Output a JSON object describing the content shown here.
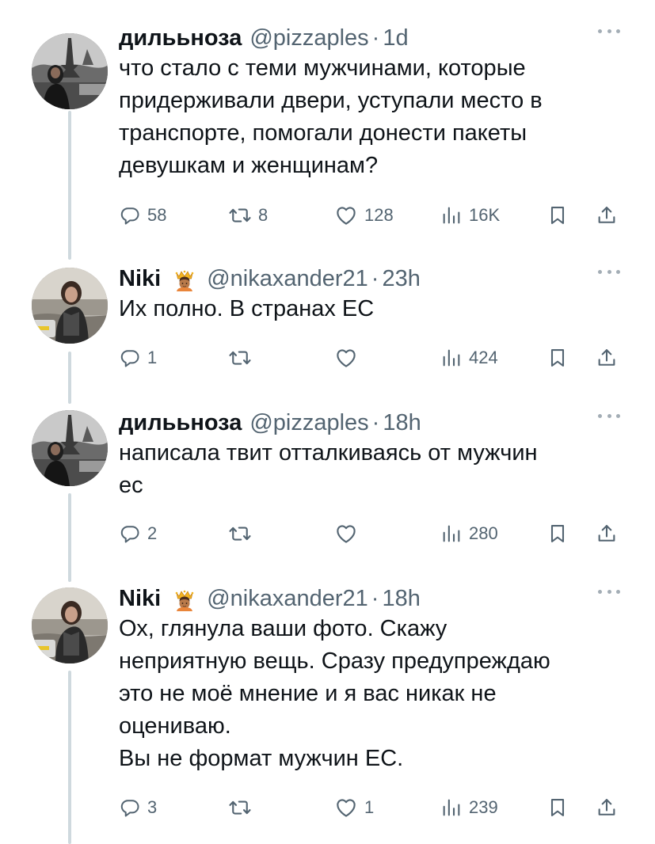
{
  "tweets": [
    {
      "author": "дилььноза",
      "handle": "@pizzaples",
      "separator": "·",
      "time": "1d",
      "verified_emoji": false,
      "lines": [
        "что стало с теми мужчинами, которые",
        "придерживали двери, уступали место в",
        "транспорте, помогали донести пакеты",
        "девушкам и женщинам?"
      ],
      "replies": "58",
      "reposts": "8",
      "likes": "128",
      "views": "16K"
    },
    {
      "author": "Niki",
      "handle": "@nikaxander21",
      "separator": "·",
      "time": "23h",
      "verified_emoji": true,
      "lines": [
        "Их полно. В странах ЕС"
      ],
      "replies": "1",
      "reposts": "",
      "likes": "",
      "views": "424"
    },
    {
      "author": "дилььноза",
      "handle": "@pizzaples",
      "separator": "·",
      "time": "18h",
      "verified_emoji": false,
      "lines": [
        "написала твит отталкиваясь от мужчин",
        "ес"
      ],
      "replies": "2",
      "reposts": "",
      "likes": "",
      "views": "280"
    },
    {
      "author": "Niki",
      "handle": "@nikaxander21",
      "separator": "·",
      "time": "18h",
      "verified_emoji": true,
      "lines": [
        "Ох, глянула ваши фото. Скажу",
        "неприятную вещь. Сразу предупреждаю",
        "это не моё мнение и я вас никак не",
        "оцениваю.",
        "Вы не формат мужчин ЕС."
      ],
      "replies": "3",
      "reposts": "",
      "likes": "1",
      "views": "239"
    }
  ],
  "icons": {
    "reply": "reply-icon",
    "repost": "repost-icon",
    "like": "heart-icon",
    "views": "views-icon",
    "bookmark": "bookmark-icon",
    "share": "share-icon",
    "more": "more-icon",
    "badge": "crown-emoji-icon"
  },
  "colors": {
    "text": "#0f1419",
    "secondary": "#536471",
    "thread_line": "#cfd9de"
  }
}
